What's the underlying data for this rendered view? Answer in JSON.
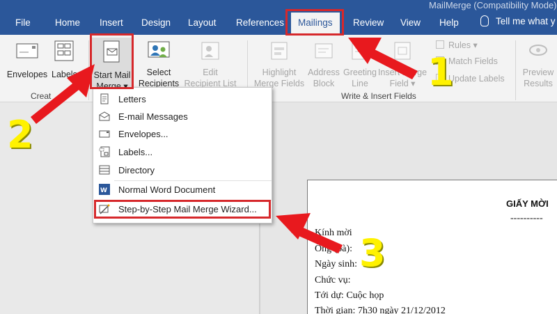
{
  "window": {
    "title": "MailMerge (Compatibility Mode)"
  },
  "tabs": [
    {
      "label": "File"
    },
    {
      "label": "Home"
    },
    {
      "label": "Insert"
    },
    {
      "label": "Design"
    },
    {
      "label": "Layout"
    },
    {
      "label": "References"
    },
    {
      "label": "Mailings"
    },
    {
      "label": "Review"
    },
    {
      "label": "View"
    },
    {
      "label": "Help"
    }
  ],
  "tell_me": "Tell me what y",
  "ribbon": {
    "create": {
      "envelopes": "Envelopes",
      "labels": "Labels",
      "group": "Creat"
    },
    "start": {
      "start_line1": "Start Mail",
      "start_line2": "Merge",
      "select_line1": "Select",
      "select_line2": "Recipients",
      "edit_line1": "Edit",
      "edit_line2": "Recipient List"
    },
    "write": {
      "highlight_line1": "Highlight",
      "highlight_line2": "Merge Fields",
      "address_line1": "Address",
      "address_line2": "Block",
      "greeting_line1": "Greeting",
      "greeting_line2": "Line",
      "insert_line1": "Insert Merge",
      "insert_line2": "Field",
      "rules": "Rules",
      "match": "Match Fields",
      "update": "Update Labels",
      "group": "Write & Insert Fields"
    },
    "preview": {
      "line1": "Preview",
      "line2": "Results"
    }
  },
  "menu": {
    "letters": "Letters",
    "email": "E-mail Messages",
    "envelopes": "Envelopes...",
    "labels": "Labels...",
    "directory": "Directory",
    "normal": "Normal Word Document",
    "wizard": "Step-by-Step Mail Merge Wizard..."
  },
  "document": {
    "heading": "GIẤY MỜI",
    "dashes": "----------",
    "lines": [
      "Kính mời",
      "Ông (bà):",
      "Ngày sinh:",
      "Chức vụ:",
      "Tới dự: Cuộc họp",
      "Thời gian: 7h30 ngày 21/12/2012"
    ]
  },
  "annotations": {
    "step1": "1",
    "step2": "2",
    "step3": "3"
  },
  "colors": {
    "ribbon_blue": "#2b579a",
    "highlight_red": "#d6282b",
    "arrow_red": "#e8191e",
    "number_yellow": "#fff200"
  }
}
